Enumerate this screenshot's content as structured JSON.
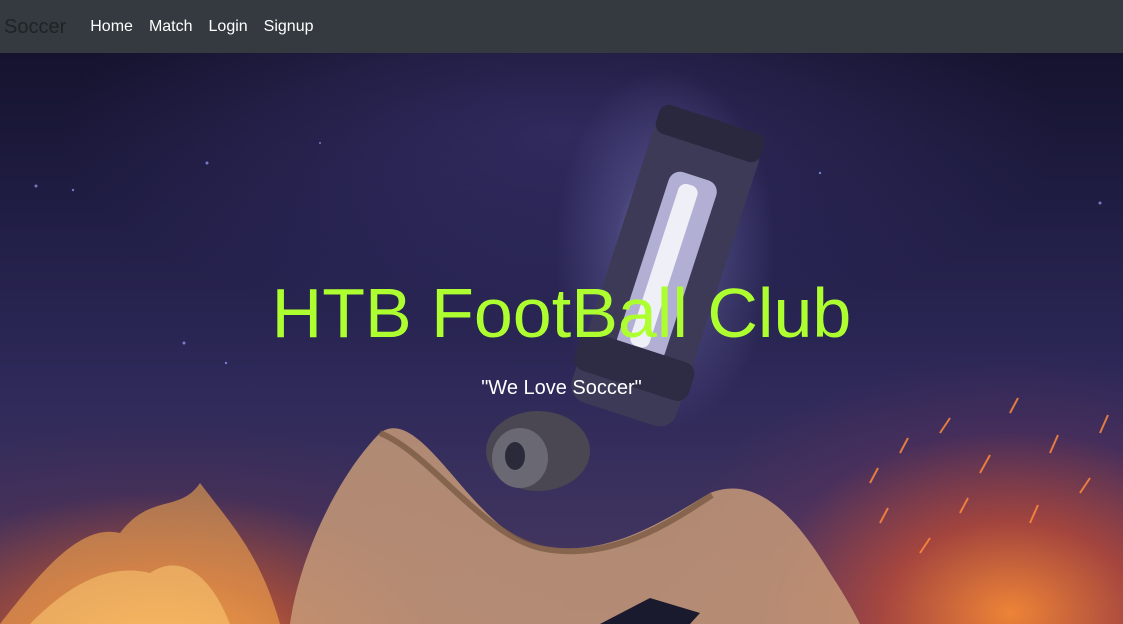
{
  "navbar": {
    "brand": "Soccer",
    "links": [
      "Home",
      "Match",
      "Login",
      "Signup"
    ]
  },
  "hero": {
    "title": "HTB FootBall Club",
    "tagline": "\"We Love Soccer\"",
    "title_color": "#adff2f",
    "background_image": "soccer-boot-with-fire-and-sparks"
  },
  "colors": {
    "navbar_bg": "#343a40",
    "nav_link": "#ffffff",
    "brand_text": "#1f2326"
  }
}
